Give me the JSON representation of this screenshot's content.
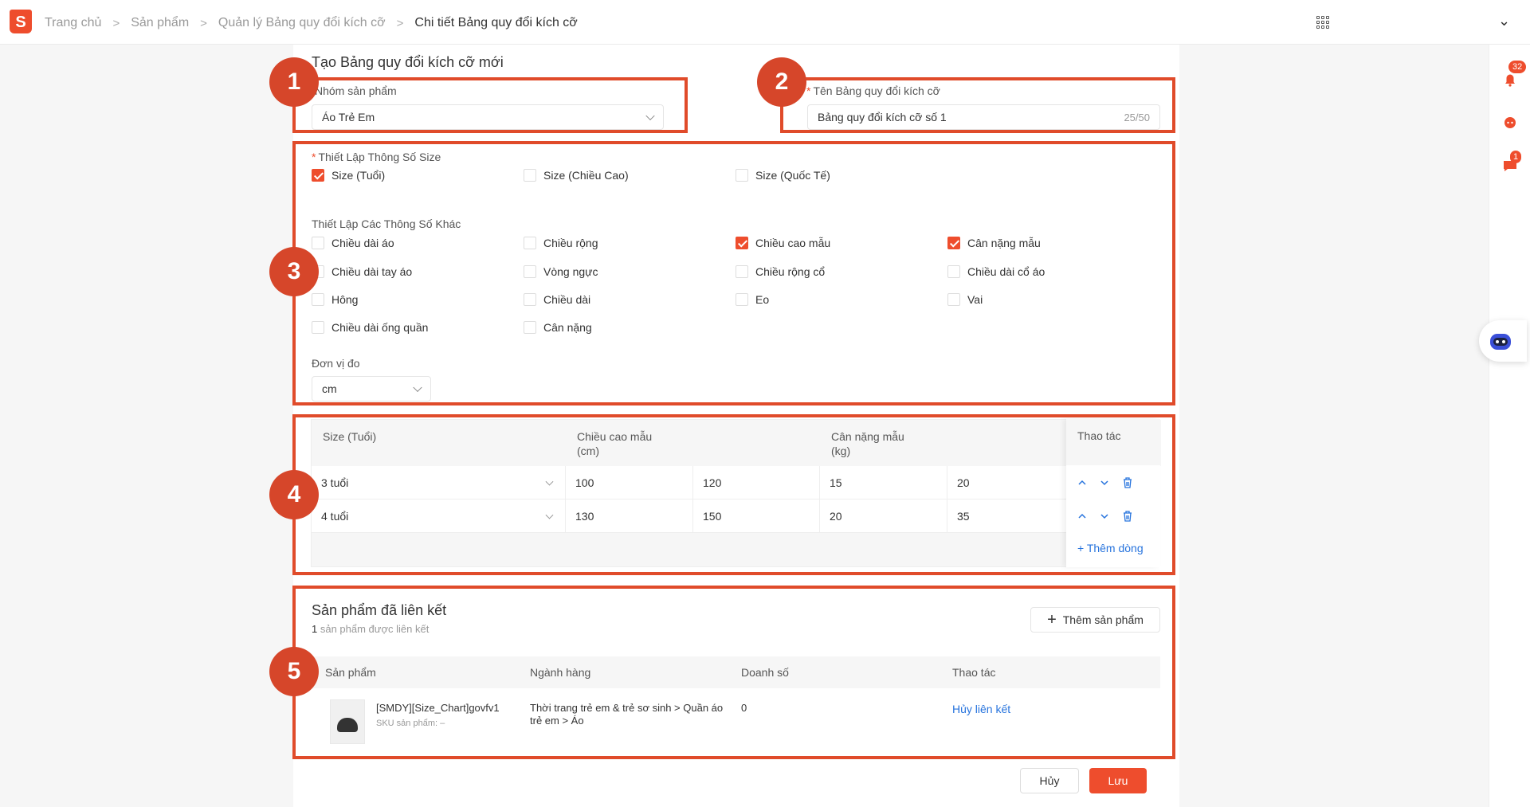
{
  "breadcrumb": [
    "Trang chủ",
    "Sản phẩm",
    "Quản lý Bảng quy đổi kích cỡ",
    "Chi tiết Bảng quy đổi kích cỡ"
  ],
  "notifications": {
    "bell_count": "32",
    "chat_count": "1"
  },
  "form": {
    "title": "Tạo Bảng quy đổi kích cỡ mới",
    "group_label": "Nhóm sản phẩm",
    "group_value": "Áo Trẻ Em",
    "name_label": "Tên Bảng quy đổi kích cỡ",
    "name_value": "Bảng quy đổi kích cỡ số 1",
    "name_counter": "25/50",
    "size_label": "Thiết Lập Thông Số Size",
    "size_options": [
      {
        "label": "Size (Tuổi)",
        "checked": true
      },
      {
        "label": "Size (Chiều Cao)",
        "checked": false
      },
      {
        "label": "Size (Quốc Tế)",
        "checked": false
      }
    ],
    "other_label": "Thiết Lập Các Thông Số Khác",
    "other_options": [
      {
        "label": "Chiều dài áo",
        "checked": false
      },
      {
        "label": "Chiều rộng",
        "checked": false
      },
      {
        "label": "Chiều cao mẫu",
        "checked": true
      },
      {
        "label": "Cân nặng mẫu",
        "checked": true
      },
      {
        "label": "Chiều dài tay áo",
        "checked": false
      },
      {
        "label": "Vòng ngực",
        "checked": false
      },
      {
        "label": "Chiều rộng cổ",
        "checked": false
      },
      {
        "label": "Chiều dài cổ áo",
        "checked": false
      },
      {
        "label": "Hông",
        "checked": false
      },
      {
        "label": "Chiều dài",
        "checked": false
      },
      {
        "label": "Eo",
        "checked": false
      },
      {
        "label": "Vai",
        "checked": false
      },
      {
        "label": "Chiều dài ống quần",
        "checked": false
      },
      {
        "label": "Cân nặng",
        "checked": false
      }
    ],
    "unit_label": "Đơn vị đo",
    "unit_value": "cm"
  },
  "size_table": {
    "headers": {
      "size": "Size (Tuổi)",
      "height": "Chiều cao mẫu",
      "height_unit": "(cm)",
      "weight": "Cân nặng mẫu",
      "weight_unit": "(kg)",
      "ops": "Thao tác"
    },
    "rows": [
      {
        "size": "3 tuổi",
        "h_min": "100",
        "h_max": "120",
        "w_min": "15",
        "w_max": "20"
      },
      {
        "size": "4 tuổi",
        "h_min": "130",
        "h_max": "150",
        "w_min": "20",
        "w_max": "35"
      }
    ],
    "add_row": "Thêm dòng"
  },
  "linked": {
    "title": "Sản phẩm đã liên kết",
    "count_num": "1",
    "count_text": " sản phẩm được liên kết",
    "add_button": "Thêm sản phẩm",
    "headers": {
      "product": "Sản phẩm",
      "category": "Ngành hàng",
      "sales": "Doanh số",
      "ops": "Thao tác"
    },
    "row": {
      "name": "[SMDY][Size_Chart]govfv1",
      "sku": "SKU sản phẩm: –",
      "category": "Thời trang trẻ em & trẻ sơ sinh > Quần áo trẻ em > Áo",
      "sales": "0",
      "action": "Hủy liên kết"
    }
  },
  "footer": {
    "cancel": "Hủy",
    "save": "Lưu"
  },
  "annotations": [
    "1",
    "2",
    "3",
    "4",
    "5"
  ],
  "colors": {
    "brand": "#ee4d2d",
    "link": "#2673dd",
    "annotation": "#d6462a"
  }
}
